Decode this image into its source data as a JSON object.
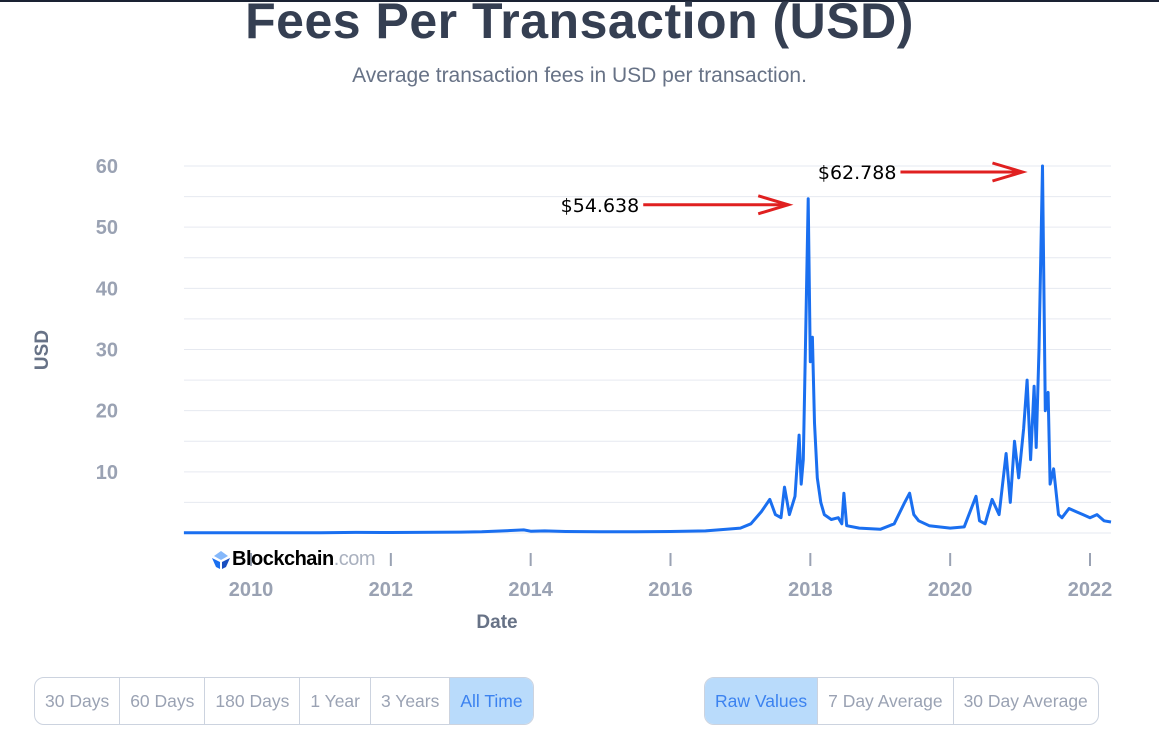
{
  "header": {
    "title": "Fees Per Transaction (USD)",
    "subtitle": "Average transaction fees in USD per transaction."
  },
  "branding": {
    "logo_name": "Blockchain",
    "logo_suffix": ".com"
  },
  "range_buttons": [
    {
      "label": "30 Days",
      "active": false
    },
    {
      "label": "60 Days",
      "active": false
    },
    {
      "label": "180 Days",
      "active": false
    },
    {
      "label": "1 Year",
      "active": false
    },
    {
      "label": "3 Years",
      "active": false
    },
    {
      "label": "All Time",
      "active": true
    }
  ],
  "smoothing_buttons": [
    {
      "label": "Raw Values",
      "active": true
    },
    {
      "label": "7 Day Average",
      "active": false
    },
    {
      "label": "30 Day Average",
      "active": false
    }
  ],
  "colors": {
    "line": "#1a6ff0",
    "annotation": "#e02020",
    "active_button_bg": "#b9dbfb",
    "active_button_text": "#3b82f0"
  },
  "chart_data": {
    "type": "line",
    "title": "Fees Per Transaction (USD)",
    "subtitle": "Average transaction fees in USD per transaction.",
    "xlabel": "Date",
    "ylabel": "USD",
    "xlim": [
      2009.04,
      2022.3
    ],
    "ylim": [
      0,
      60
    ],
    "x_ticks": [
      2010,
      2012,
      2014,
      2016,
      2018,
      2020,
      2022
    ],
    "x_tick_labels": [
      "2010",
      "2012",
      "2014",
      "2016",
      "2018",
      "2020",
      "2022"
    ],
    "y_ticks": [
      10,
      20,
      30,
      40,
      50,
      60
    ],
    "y_tick_labels": [
      "10",
      "20",
      "30",
      "40",
      "50",
      "60"
    ],
    "grid": true,
    "grid_step": 5,
    "legend": "none",
    "series": [
      {
        "name": "Fees Per Transaction (USD)",
        "x": [
          2009.04,
          2010.0,
          2011.0,
          2011.5,
          2012.0,
          2013.0,
          2013.3,
          2013.9,
          2014.0,
          2014.2,
          2014.5,
          2015.0,
          2015.5,
          2016.0,
          2016.5,
          2016.8,
          2017.0,
          2017.15,
          2017.3,
          2017.42,
          2017.5,
          2017.58,
          2017.63,
          2017.7,
          2017.78,
          2017.84,
          2017.87,
          2017.9,
          2017.93,
          2017.97,
          2018.0,
          2018.03,
          2018.06,
          2018.1,
          2018.15,
          2018.2,
          2018.3,
          2018.4,
          2018.45,
          2018.48,
          2018.52,
          2018.7,
          2019.0,
          2019.2,
          2019.35,
          2019.42,
          2019.48,
          2019.55,
          2019.7,
          2020.0,
          2020.2,
          2020.37,
          2020.42,
          2020.5,
          2020.6,
          2020.7,
          2020.8,
          2020.86,
          2020.92,
          2020.98,
          2021.05,
          2021.1,
          2021.15,
          2021.2,
          2021.23,
          2021.27,
          2021.32,
          2021.36,
          2021.4,
          2021.43,
          2021.48,
          2021.55,
          2021.6,
          2021.7,
          2021.8,
          2021.9,
          2022.0,
          2022.1,
          2022.2,
          2022.3
        ],
        "y": [
          0.05,
          0.05,
          0.05,
          0.1,
          0.08,
          0.15,
          0.2,
          0.5,
          0.3,
          0.35,
          0.25,
          0.2,
          0.2,
          0.25,
          0.35,
          0.6,
          0.8,
          1.5,
          3.5,
          5.5,
          3.0,
          2.5,
          7.5,
          3.0,
          6.0,
          16.0,
          8.0,
          12.0,
          30.0,
          54.638,
          28.0,
          32.0,
          18.0,
          9.0,
          5.0,
          3.0,
          2.2,
          2.5,
          1.5,
          6.5,
          1.2,
          0.8,
          0.6,
          1.5,
          5.0,
          6.5,
          3.0,
          2.0,
          1.2,
          0.8,
          1.0,
          6.0,
          2.0,
          1.5,
          5.5,
          3.0,
          13.0,
          5.0,
          15.0,
          9.0,
          17.0,
          25.0,
          12.0,
          24.0,
          14.0,
          30.0,
          62.788,
          20.0,
          23.0,
          8.0,
          10.5,
          3.0,
          2.5,
          4.0,
          3.5,
          3.0,
          2.5,
          3.0,
          2.0,
          1.8
        ]
      }
    ],
    "annotations": [
      {
        "text": "$54.638",
        "x": 2017.97,
        "y": 54.638,
        "arrow": true
      },
      {
        "text": "$62.788",
        "x": 2021.32,
        "y": 62.788,
        "arrow": true
      }
    ]
  }
}
